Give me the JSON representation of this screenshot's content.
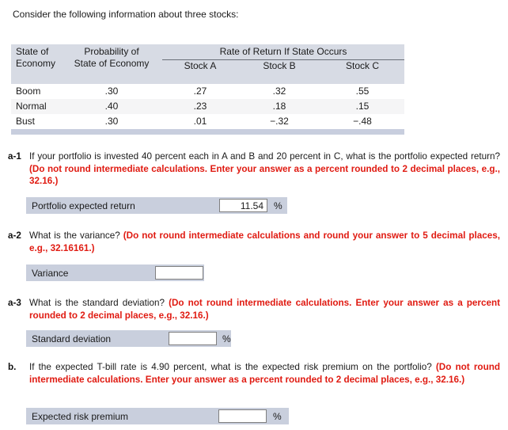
{
  "intro": "Consider the following information about three stocks:",
  "table": {
    "group_header": "Rate of Return If State Occurs",
    "col_state": "State of\nEconomy",
    "col_state_line1": "State of",
    "col_state_line2": "Economy",
    "col_prob_line1": "Probability of",
    "col_prob_line2": "State of Economy",
    "col_a": "Stock A",
    "col_b": "Stock B",
    "col_c": "Stock C",
    "rows": [
      {
        "state": "Boom",
        "prob": ".30",
        "a": ".27",
        "b": ".32",
        "c": ".55"
      },
      {
        "state": "Normal",
        "prob": ".40",
        "a": ".23",
        "b": ".18",
        "c": ".15"
      },
      {
        "state": "Bust",
        "prob": ".30",
        "a": ".01",
        "b": "−.32",
        "c": "−.48"
      }
    ]
  },
  "questions": {
    "a1": {
      "label": "a-1",
      "text_plain": "If your portfolio is invested 40 percent each in A and B and 20 percent in C, what is the portfolio expected return? ",
      "text_red": "(Do not round intermediate calculations. Enter your answer as a percent rounded to 2 decimal places, e.g., 32.16.)",
      "answer_label": "Portfolio expected return",
      "answer_value": "11.54",
      "answer_placeholder": "",
      "unit": "%"
    },
    "a2": {
      "label": "a-2",
      "text_plain": "What is the variance? ",
      "text_red": "(Do not round intermediate calculations and round your answer to 5 decimal places, e.g., 32.16161.)",
      "answer_label": "Variance",
      "answer_value": "",
      "answer_placeholder": "",
      "unit": ""
    },
    "a3": {
      "label": "a-3",
      "text_plain": "What is the standard deviation? ",
      "text_red": "(Do not round intermediate calculations. Enter your answer as a percent rounded to 2 decimal places, e.g., 32.16.)",
      "answer_label": "Standard deviation",
      "answer_value": "",
      "answer_placeholder": "",
      "unit": "%"
    },
    "b": {
      "label": "b.",
      "text_plain": "If the expected T-bill rate is 4.90 percent, what is the expected risk premium on the portfolio? ",
      "text_red": "(Do not round intermediate calculations. Enter your answer as a percent rounded to 2 decimal places, e.g., 32.16.)",
      "answer_label": "Expected risk premium",
      "answer_value": "",
      "answer_placeholder": "",
      "unit": "%"
    }
  },
  "colors": {
    "table_header_bg": "#d7dbe4",
    "table_footer_bg": "#c8cede",
    "row_alt_bg": "#f5f5f6",
    "answer_row_bg": "#c9cfdd",
    "red_instruction": "#e01b12"
  }
}
